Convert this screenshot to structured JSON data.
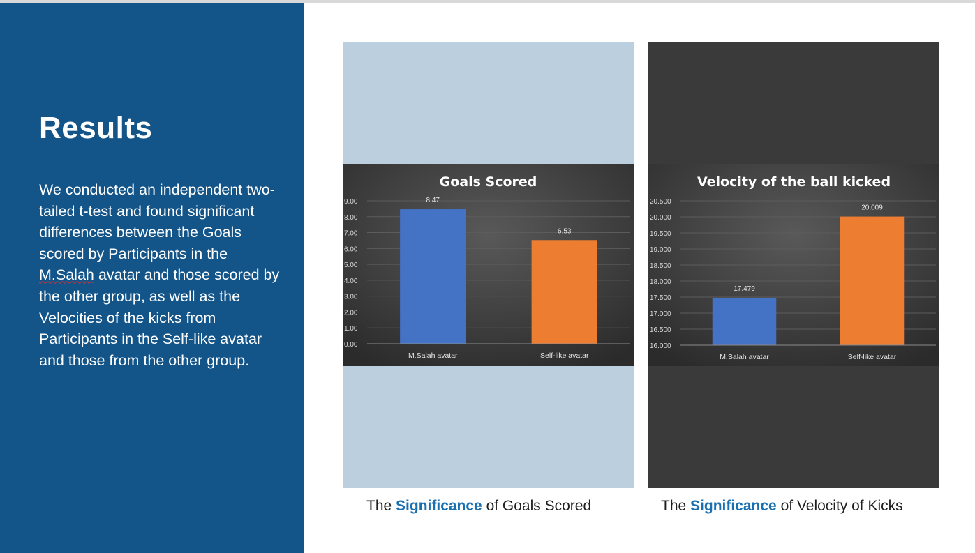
{
  "slide": {
    "title": "Results",
    "body_before": "We conducted an independent two-tailed t-test and found significant differences between the Goals scored by Participants in the ",
    "body_flagged": "M.Salah",
    "body_after": " avatar and those scored by the other group, as well as the Velocities of the kicks from Participants in the Self-like avatar and those from the other group."
  },
  "captions": [
    {
      "pre": "The ",
      "highlight": "Significance",
      "post": " of Goals Scored"
    },
    {
      "pre": "The ",
      "highlight": "Significance",
      "post": " of Velocity of Kicks"
    }
  ],
  "colors": {
    "left_panel": "#135489",
    "caption_highlight": "#1a6fb0",
    "frame1_bg": "#bccfde",
    "frame2_bg": "#3a3a3a",
    "bar_blue": "#4472c4",
    "bar_orange": "#ed7d31"
  },
  "chart_data": [
    {
      "type": "bar",
      "title": "Goals Scored",
      "categories": [
        "M.Salah avatar",
        "Self-like avatar"
      ],
      "values": [
        8.47,
        6.53
      ],
      "value_labels": [
        "8.47",
        "6.53"
      ],
      "bar_colors": [
        "#4472c4",
        "#ed7d31"
      ],
      "ylim": [
        0,
        9
      ],
      "yticks": [
        0,
        1,
        2,
        3,
        4,
        5,
        6,
        7,
        8,
        9
      ],
      "ytick_labels": [
        "0.00",
        "1.00",
        "2.00",
        "3.00",
        "4.00",
        "5.00",
        "6.00",
        "7.00",
        "8.00",
        "9.00"
      ],
      "xlabel": "",
      "ylabel": "",
      "grid": true
    },
    {
      "type": "bar",
      "title": "Velocity of the ball kicked",
      "categories": [
        "M.Salah avatar",
        "Self-like avatar"
      ],
      "values": [
        17.479,
        20.009
      ],
      "value_labels": [
        "17.479",
        "20.009"
      ],
      "bar_colors": [
        "#4472c4",
        "#ed7d31"
      ],
      "ylim": [
        16,
        20.5
      ],
      "yticks": [
        16,
        16.5,
        17,
        17.5,
        18,
        18.5,
        19,
        19.5,
        20,
        20.5
      ],
      "ytick_labels": [
        "16.000",
        "16.500",
        "17.000",
        "17.500",
        "18.000",
        "18.500",
        "19.000",
        "19.500",
        "20.000",
        "20.500"
      ],
      "xlabel": "",
      "ylabel": "",
      "grid": true
    }
  ]
}
